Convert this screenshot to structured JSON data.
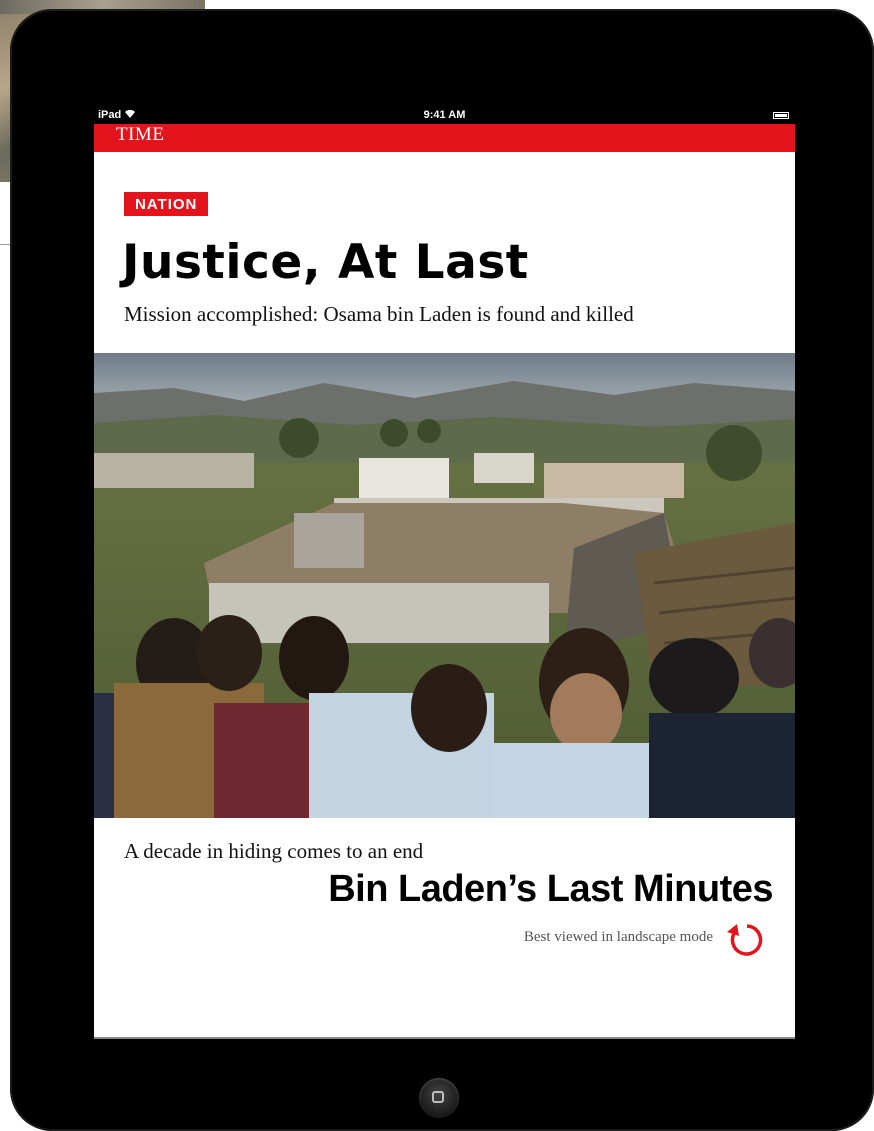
{
  "status_bar": {
    "carrier": "iPad",
    "wifi_icon": "wifi-icon",
    "time": "9:41 AM",
    "battery_icon": "battery-icon"
  },
  "masthead": {
    "logo": "TIME",
    "color": "#e3141c"
  },
  "article": {
    "section": "NATION",
    "headline": "Justice, At Last",
    "dek": "Mission accomplished: Osama bin Laden is found and killed",
    "kicker": "A decade in hiding comes to an end",
    "story_title": "Bin Laden’s Last Minutes",
    "orientation_hint": "Best viewed in landscape mode",
    "rotate_icon": "rotate-icon"
  },
  "device": {
    "home_button_icon": "home-button-icon"
  }
}
